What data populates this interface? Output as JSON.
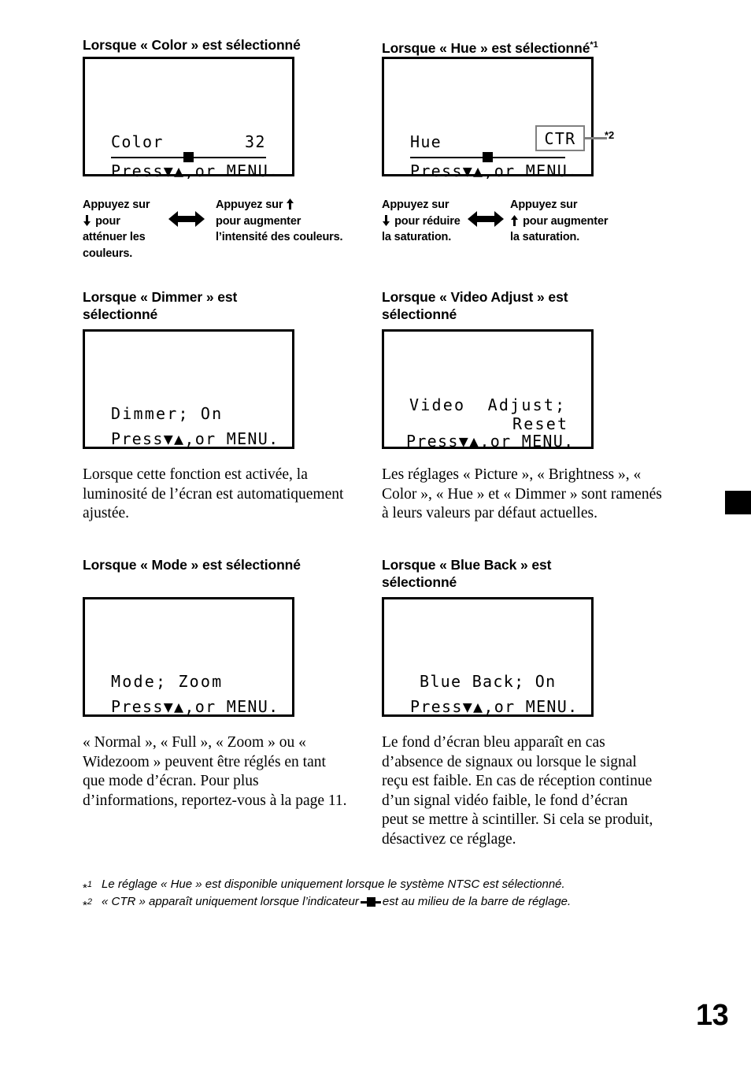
{
  "page": {
    "number": "13",
    "thumb_tab_color": "#000000"
  },
  "sections": [
    {
      "id": "color",
      "heading": "Lorsque « Color » est sélectionné",
      "heading_sup": "",
      "lcd": {
        "label": "Color",
        "value": "32",
        "hint": "Press▼▲,or MENU.",
        "has_slider": true
      }
    },
    {
      "id": "hue",
      "heading": "Lorsque « Hue » est sélectionné",
      "heading_sup": "*1",
      "lcd": {
        "label": "Hue",
        "value": "CTR",
        "hint": "Press▼▲,or MENU.",
        "has_slider": true,
        "value_boxed": true,
        "callout": "*2"
      }
    },
    {
      "id": "dimmer",
      "heading": "Lorsque « Dimmer » est sélectionné",
      "lcd": {
        "line1": "Dimmer; On",
        "hint": "Press▼▲,or MENU.",
        "has_slider": false
      },
      "body": "Lorsque cette fonction est activée, la luminosité de l’écran est automatiquement ajustée."
    },
    {
      "id": "video-adjust",
      "heading": "Lorsque « Video Adjust » est sélectionné",
      "lcd": {
        "line1": "Video  Adjust;",
        "line2": "Reset",
        "hint": "Press▼▲,or MENU.",
        "has_slider": false
      },
      "body": "Les réglages « Picture », « Brightness », « Color », « Hue » et « Dimmer » sont ramenés à leurs valeurs par défaut actuelles."
    },
    {
      "id": "mode",
      "heading": "Lorsque « Mode » est sélectionné",
      "lcd": {
        "line1": "Mode; Zoom",
        "hint": "Press▼▲,or MENU.",
        "has_slider": false
      },
      "body": "« Normal », « Full », « Zoom » ou « Widezoom » peuvent être réglés en tant que mode d’écran. Pour plus d’informations, reportez-vous à la page 11."
    },
    {
      "id": "blue-back",
      "heading": "Lorsque « Blue Back » est sélectionné",
      "lcd": {
        "line1": "Blue Back; On",
        "hint": "Press▼▲,or MENU.",
        "has_slider": false
      },
      "body": "Le fond d’écran bleu apparaît en cas d’absence de signaux ou lorsque le signal reçu est faible. En cas de réception continue d’un signal vidéo faible, le fond d’écran peut se mettre à scintiller. Si cela se produit, désactivez ce réglage."
    }
  ],
  "instructions": {
    "color": {
      "left": "Appuyez sur ⬇ pour atténuer les couleurs.",
      "left_pre": "Appuyez sur",
      "left_post": "pour atténuer les couleurs.",
      "left_glyph": "⬇",
      "right_pre": "Appuyez sur",
      "right_glyph": "⬆",
      "right_post": "pour augmenter l’intensité des couleurs.",
      "arrow": "left-right-arrow"
    },
    "hue": {
      "left_pre": "Appuyez sur",
      "left_glyph": "⬇",
      "left_post": "pour réduire la saturation.",
      "right_pre": "Appuyez sur",
      "right_glyph": "⬆",
      "right_post": "pour augmenter la saturation.",
      "arrow": "left-right-arrow"
    }
  },
  "footnotes": [
    {
      "mark": "*1",
      "text": "Le réglage « Hue » est disponible uniquement lorsque le système NTSC est sélectionné."
    },
    {
      "mark": "*2",
      "text_before": "« CTR » apparaît uniquement lorsque l’indicateur",
      "indicator": "slider-center-indicator",
      "text_after": "est au milieu de la barre de réglage."
    }
  ]
}
